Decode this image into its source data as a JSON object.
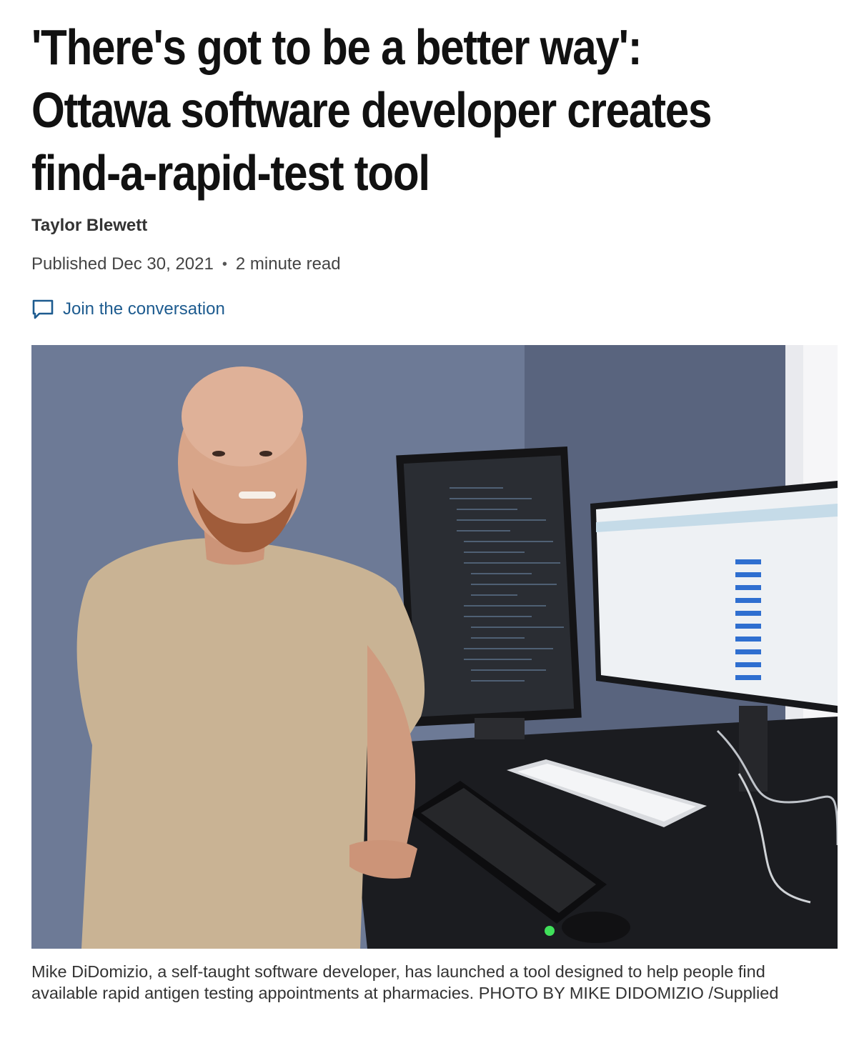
{
  "article": {
    "headline_line1": "'There's got to be a better way':",
    "headline_line2": "Ottawa software developer creates",
    "headline_line3": "find-a-rapid-test tool",
    "author": "Taylor Blewett",
    "published": "Published Dec 30, 2021",
    "separator": "•",
    "read_time": "2 minute read",
    "comments_label": "Join the conversation",
    "comments_icon": "speech-bubble-icon",
    "photo_caption": "Mike DiDomizio, a self-taught software developer, has launched a tool designed to help people find available rapid antigen testing appointments at pharmacies. PHOTO BY MIKE DIDOMIZIO /Supplied"
  },
  "colors": {
    "link": "#1d5b8f",
    "headline": "#111111",
    "wall": "#6b7893"
  }
}
